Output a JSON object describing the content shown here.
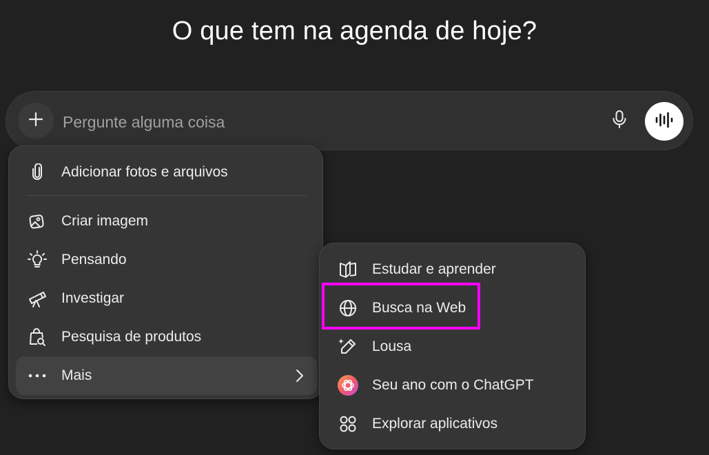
{
  "headline": "O que tem na agenda de hoje?",
  "composer": {
    "placeholder": "Pergunte alguma coisa",
    "add_icon": "plus-icon",
    "mic_icon": "microphone-icon",
    "voice_icon": "voice-waveform-icon"
  },
  "menu": {
    "items": [
      {
        "label": "Adicionar fotos e arquivos",
        "icon": "paperclip-icon"
      },
      {
        "label": "Criar imagem",
        "icon": "image-create-icon"
      },
      {
        "label": "Pensando",
        "icon": "lightbulb-icon"
      },
      {
        "label": "Investigar",
        "icon": "telescope-icon"
      },
      {
        "label": "Pesquisa de produtos",
        "icon": "shopping-bag-search-icon"
      },
      {
        "label": "Mais",
        "icon": "more-dots-icon"
      }
    ]
  },
  "submenu": {
    "items": [
      {
        "label": "Estudar e aprender",
        "icon": "book-open-icon"
      },
      {
        "label": "Busca na Web",
        "icon": "globe-icon"
      },
      {
        "label": "Lousa",
        "icon": "pencil-canvas-icon"
      },
      {
        "label": "Seu ano com o ChatGPT",
        "icon": "chatgpt-logo-icon"
      },
      {
        "label": "Explorar aplicativos",
        "icon": "apps-grid-icon"
      }
    ]
  },
  "colors": {
    "background": "#212121",
    "surface": "#303030",
    "menu": "#353535",
    "highlight": "#ff00ff"
  }
}
